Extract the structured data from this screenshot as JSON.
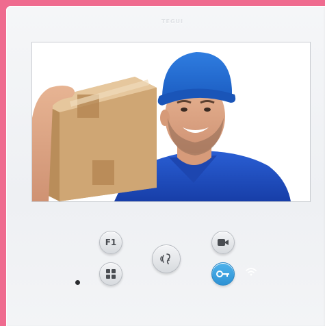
{
  "device": {
    "brand_label": "TEGUI"
  },
  "screen": {
    "image": "video-feed-delivery-man"
  },
  "buttons": {
    "f1_label": "F1",
    "menu_icon": "grid-icon",
    "talk_icon": "talk-icon",
    "camera_icon": "camera-icon",
    "key_icon": "key-icon"
  },
  "indicators": {
    "wifi_icon": "wifi-icon",
    "mic_icon": "microphone-dot"
  },
  "colors": {
    "frame": "#ef6b8f",
    "device": "#f2f3f5",
    "accent_blue": "#3aa3e0",
    "button_gray": "#dfe1e5"
  }
}
